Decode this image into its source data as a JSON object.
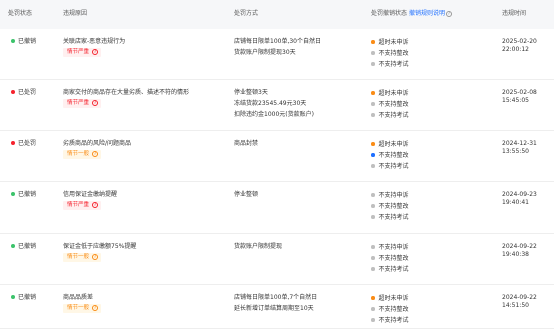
{
  "header": {
    "columns": [
      "处罚状态",
      "违规原因",
      "处罚方式",
      "处罚撤销状态",
      "违规时间"
    ],
    "appeal_extra": "撤销规则说明",
    "help_icon": "question-circle-icon"
  },
  "colors": {
    "green": "#3cc36b",
    "red": "#f5222d",
    "orange": "#fa8c16",
    "blue": "#1e6fff",
    "gray": "#bfbfbf",
    "header_bg": "#f6f7f9"
  },
  "records": [
    {
      "status": "已撤销",
      "status_color": "#3cc36b",
      "reason": "关联店家-恶意违规行为",
      "severity": "情节严重",
      "severity_style": "red",
      "methods": [
        "店铺每日限单100单,30个自然日",
        "货款账户限制提现30天"
      ],
      "appeal": [
        {
          "text": "超时未申诉",
          "color": "#fa8c16"
        },
        {
          "text": "不支持整改",
          "color": "#bfbfbf"
        },
        {
          "text": "不支持考试",
          "color": "#bfbfbf"
        }
      ],
      "date": "2025-02-20",
      "time": "22:00:12"
    },
    {
      "status": "已处罚",
      "status_color": "#f5222d",
      "reason": "商家交付的商品存在大量劣质、描述不符的情形",
      "severity": "情节严重",
      "severity_style": "red",
      "methods": [
        "停业整顿3天",
        "冻结货款23545.49元30天",
        "扣除违约金1000元(货款账户)"
      ],
      "appeal": [
        {
          "text": "超时未申诉",
          "color": "#fa8c16"
        },
        {
          "text": "不支持整改",
          "color": "#bfbfbf"
        },
        {
          "text": "不支持考试",
          "color": "#bfbfbf"
        }
      ],
      "date": "2025-02-08",
      "time": "15:45:05"
    },
    {
      "status": "已处罚",
      "status_color": "#f5222d",
      "reason": "劣质商品的风险/问题商品",
      "severity": "情节一般",
      "severity_style": "orange",
      "methods": [
        "商品封禁"
      ],
      "appeal": [
        {
          "text": "超时未申诉",
          "color": "#fa8c16"
        },
        {
          "text": "不支持整改",
          "color": "#1e6fff"
        },
        {
          "text": "不支持考试",
          "color": "#bfbfbf"
        }
      ],
      "date": "2024-12-31",
      "time": "13:55:50"
    },
    {
      "status": "已撤销",
      "status_color": "#3cc36b",
      "reason": "信用保证金缴纳提醒",
      "severity": "情节严重",
      "severity_style": "red",
      "methods": [
        "停业整顿"
      ],
      "appeal": [
        {
          "text": "不支持申诉",
          "color": "#bfbfbf"
        },
        {
          "text": "不支持整改",
          "color": "#bfbfbf"
        },
        {
          "text": "不支持考试",
          "color": "#bfbfbf"
        }
      ],
      "date": "2024-09-23",
      "time": "19:40:41"
    },
    {
      "status": "已撤销",
      "status_color": "#3cc36b",
      "reason": "保证金低于应缴额75%提醒",
      "severity": "情节一般",
      "severity_style": "orange",
      "methods": [
        "货款账户限制提现"
      ],
      "appeal": [
        {
          "text": "不支持申诉",
          "color": "#bfbfbf"
        },
        {
          "text": "不支持整改",
          "color": "#bfbfbf"
        },
        {
          "text": "不支持考试",
          "color": "#bfbfbf"
        }
      ],
      "date": "2024-09-22",
      "time": "19:40:38"
    },
    {
      "status": "已撤销",
      "status_color": "#3cc36b",
      "reason": "商品品质差",
      "severity": "情节一般",
      "severity_style": "orange",
      "methods": [
        "店铺每日限单100单,7个自然日",
        "延长新增订单结算周期至10天"
      ],
      "appeal": [
        {
          "text": "超时未申诉",
          "color": "#fa8c16"
        },
        {
          "text": "不支持整改",
          "color": "#bfbfbf"
        },
        {
          "text": "不支持考试",
          "color": "#bfbfbf"
        }
      ],
      "date": "2024-09-22",
      "time": "14:51:50"
    }
  ]
}
